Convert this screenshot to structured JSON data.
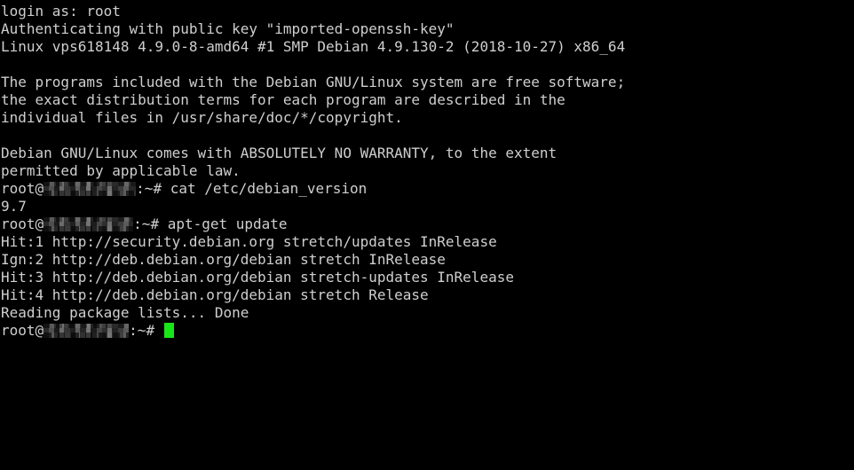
{
  "terminal": {
    "app": "ssh-terminal-session",
    "background_color": "#000000",
    "text_color": "#cfcfcf",
    "cursor_color": "#19e619",
    "cursor_shape": "block",
    "columns": 83,
    "rows": 26,
    "lines": [
      {
        "id": "l01",
        "type": "text",
        "text": "login as: root"
      },
      {
        "id": "l02",
        "type": "text",
        "text": "Authenticating with public key \"imported-openssh-key\""
      },
      {
        "id": "l03",
        "type": "text",
        "text": "Linux vps618148 4.9.0-8-amd64 #1 SMP Debian 4.9.130-2 (2018-10-27) x86_64"
      },
      {
        "id": "l04",
        "type": "blank",
        "text": ""
      },
      {
        "id": "l05",
        "type": "text",
        "text": "The programs included with the Debian GNU/Linux system are free software;"
      },
      {
        "id": "l06",
        "type": "text",
        "text": "the exact distribution terms for each program are described in the"
      },
      {
        "id": "l07",
        "type": "text",
        "text": "individual files in /usr/share/doc/*/copyright."
      },
      {
        "id": "l08",
        "type": "blank",
        "text": ""
      },
      {
        "id": "l09",
        "type": "text",
        "text": "Debian GNU/Linux comes with ABSOLUTELY NO WARRANTY, to the extent"
      },
      {
        "id": "l10",
        "type": "text",
        "text": "permitted by applicable law."
      },
      {
        "id": "l11",
        "type": "prompt",
        "user": "root",
        "at": "@",
        "host_redacted": true,
        "tail": ":~# ",
        "command": "cat /etc/debian_version",
        "cursor": false
      },
      {
        "id": "l12",
        "type": "text",
        "text": "9.7"
      },
      {
        "id": "l13",
        "type": "prompt",
        "user": "root",
        "at": "@",
        "host_redacted": true,
        "tail": ":~# ",
        "command": "apt-get update",
        "cursor": false
      },
      {
        "id": "l14",
        "type": "text",
        "text": "Hit:1 http://security.debian.org stretch/updates InRelease"
      },
      {
        "id": "l15",
        "type": "text",
        "text": "Ign:2 http://deb.debian.org/debian stretch InRelease"
      },
      {
        "id": "l16",
        "type": "text",
        "text": "Hit:3 http://deb.debian.org/debian stretch-updates InRelease"
      },
      {
        "id": "l17",
        "type": "text",
        "text": "Hit:4 http://deb.debian.org/debian stretch Release"
      },
      {
        "id": "l18",
        "type": "text",
        "text": "Reading package lists... Done"
      },
      {
        "id": "l19",
        "type": "prompt",
        "user": "root",
        "at": "@",
        "host_redacted": true,
        "tail": ":~# ",
        "command": "",
        "cursor": true
      }
    ]
  }
}
